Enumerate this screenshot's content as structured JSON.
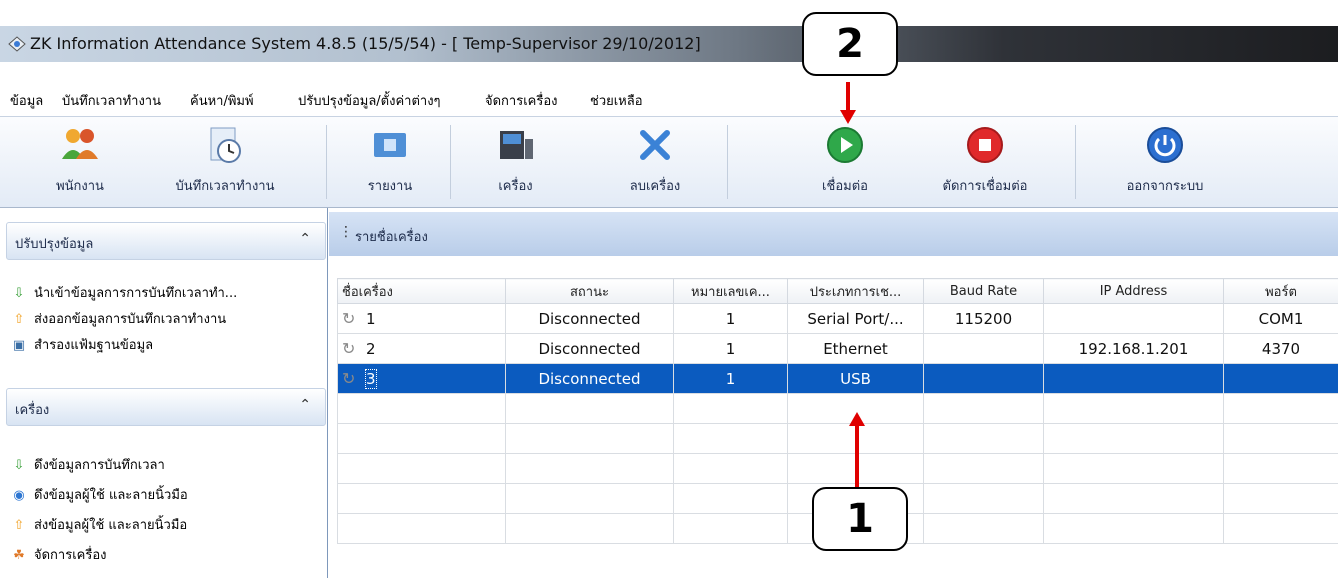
{
  "window": {
    "title": "ZK Information Attendance System 4.8.5 (15/5/54) - [ Temp-Supervisor 29/10/2012]"
  },
  "menu": [
    {
      "label": "ข้อมูล"
    },
    {
      "label": "บันทึกเวลาทำงาน"
    },
    {
      "label": "ค้นหา/พิมพ์"
    },
    {
      "label": "ปรับปรุงข้อมูล/ตั้งค่าต่างๆ"
    },
    {
      "label": "จัดการเครื่อง"
    },
    {
      "label": "ช่วยเหลือ"
    }
  ],
  "toolbar": {
    "buttons": [
      {
        "label": "พนักงาน",
        "icon": "users-icon"
      },
      {
        "label": "บันทึกเวลาทำงาน",
        "icon": "clock-document-icon"
      },
      {
        "label": "รายงาน",
        "icon": "report-folder-icon"
      },
      {
        "label": "เครื่อง",
        "icon": "device-icon"
      },
      {
        "label": "ลบเครื่อง",
        "icon": "delete-x-icon"
      },
      {
        "label": "เชื่อมต่อ",
        "icon": "connect-play-icon"
      },
      {
        "label": "ตัดการเชื่อมต่อ",
        "icon": "disconnect-stop-icon"
      },
      {
        "label": "ออกจากระบบ",
        "icon": "power-icon"
      }
    ]
  },
  "sidebar": {
    "panels": [
      {
        "header": "ปรับปรุงข้อมูล",
        "items": [
          {
            "label": "นำเข้าข้อมูลการการบันทึกเวลาทำ...",
            "icon": "green-arrow-down-icon"
          },
          {
            "label": "ส่งออกข้อมูลการบันทึกเวลาทำงาน",
            "icon": "orange-arrow-up-icon"
          },
          {
            "label": "สำรองแฟ้มฐานข้อมูล",
            "icon": "backup-icon"
          }
        ]
      },
      {
        "header": "เครื่อง",
        "items": [
          {
            "label": "ดึงข้อมูลการบันทึกเวลา",
            "icon": "green-arrow-down-icon"
          },
          {
            "label": "ดึงข้อมูลผู้ใช้ และลายนิ้วมือ",
            "icon": "blue-circle-icon"
          },
          {
            "label": "ส่งข้อมูลผู้ใช้ และลายนิ้วมือ",
            "icon": "orange-arrow-up-icon"
          },
          {
            "label": "จัดการเครื่อง",
            "icon": "device-manage-icon"
          }
        ]
      }
    ]
  },
  "main": {
    "header": "รายชื่อเครื่อง",
    "columns": [
      "ชื่อเครื่อง",
      "สถานะ",
      "หมายเลขเค...",
      "ประเภทการเช...",
      "Baud Rate",
      "IP Address",
      "พอร์ต"
    ],
    "rows": [
      {
        "name": "1",
        "status": "Disconnected",
        "number": "1",
        "type": "Serial Port/...",
        "baud": "115200",
        "ip": "",
        "port": "COM1",
        "selected": false
      },
      {
        "name": "2",
        "status": "Disconnected",
        "number": "1",
        "type": "Ethernet",
        "baud": "",
        "ip": "192.168.1.201",
        "port": "4370",
        "selected": false
      },
      {
        "name": "3",
        "status": "Disconnected",
        "number": "1",
        "type": "USB",
        "baud": "",
        "ip": "",
        "port": "",
        "selected": true
      }
    ],
    "empty_rows": 5
  },
  "annotations": {
    "callout_1": "1",
    "callout_2": "2",
    "arrow_color": "#e00000"
  }
}
